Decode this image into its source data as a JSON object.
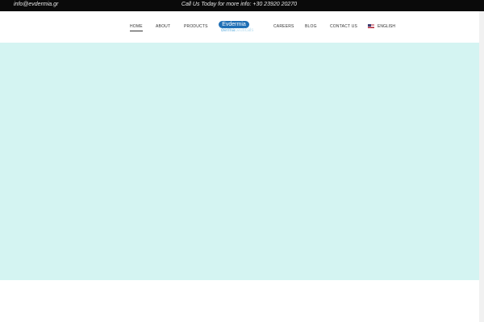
{
  "topbar": {
    "email": "info@evdermia.gr",
    "call": "Call Us Today for more info: +30 23920 20270"
  },
  "nav": {
    "home": "HOME",
    "about": "ABOUT",
    "products": "PRODUCTS",
    "careers": "CAREERS",
    "blog": "BLOG",
    "contact": "CONTACT US"
  },
  "logo": {
    "brand": "Evdermia",
    "sub_part1": "derma",
    "sub_part2": "ceuticals"
  },
  "language": {
    "label": "ENGLISH",
    "flag_icon": "us-flag-icon"
  },
  "colors": {
    "topbar_bg": "#0a0a0a",
    "hero_bg": "#d4f4f2",
    "logo_blue": "#1f6fb5"
  }
}
